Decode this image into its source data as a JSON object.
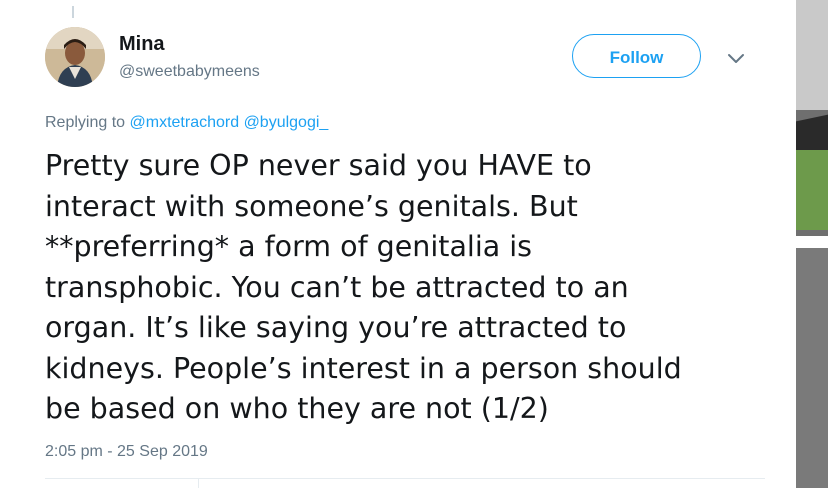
{
  "tweet": {
    "author": {
      "display_name": "Mina",
      "handle": "@sweetbabymeens",
      "avatar_icon": "profile-photo"
    },
    "follow_label": "Follow",
    "menu_icon": "chevron-down-icon",
    "reply_context": {
      "prefix": "Replying to",
      "mentions": [
        "@mxtetrachord",
        "@byulgogi_"
      ]
    },
    "text_lines": [
      "Pretty sure OP never said you HAVE to",
      "interact with someone’s genitals. But",
      "**preferring* a form of genitalia is",
      "transphobic. You can’t be attracted to an",
      "organ. It’s like saying you’re attracted to",
      "kidneys. People’s interest in a person should",
      "be based on who they are not (1/2)"
    ],
    "timestamp": "2:05 pm - 25 Sep 2019"
  },
  "colors": {
    "accent": "#1da1f2",
    "secondary_text": "#657786",
    "primary_text": "#14171a",
    "divider": "#e6ecf0"
  }
}
